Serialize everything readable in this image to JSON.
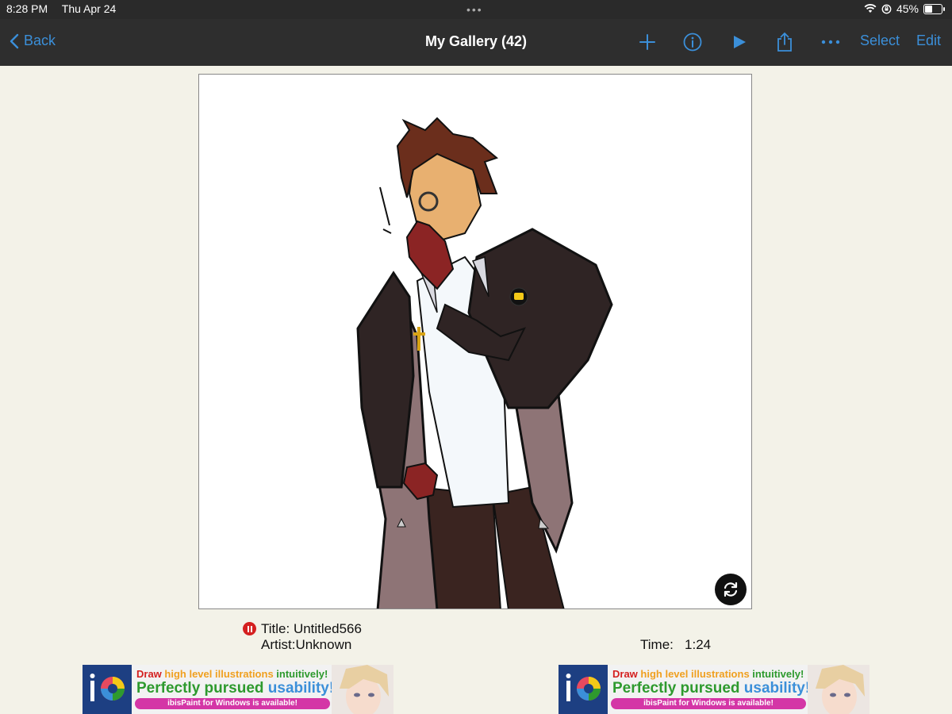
{
  "status": {
    "time": "8:28 PM",
    "date": "Thu Apr 24",
    "battery": "45%",
    "battery_level": 0.45
  },
  "nav": {
    "back": "Back",
    "title": "My Gallery (42)",
    "select": "Select",
    "edit": "Edit"
  },
  "icons": [
    "chevron-left-icon",
    "plus-icon",
    "info-icon",
    "play-icon",
    "share-icon",
    "ellipsis-icon",
    "rotate-icon",
    "stop-icon",
    "wifi-icon",
    "lock-rotation-icon",
    "battery-icon"
  ],
  "artwork": {
    "title_label": "Title:",
    "title": "Untitled566",
    "artist_label": "Artist:",
    "artist": "Unknown",
    "time_label": "Time:",
    "time": "1:24"
  },
  "ad": {
    "line1_a": "Draw",
    "line1_b": "high level illustrations",
    "line1_c": "intuitively!",
    "line2_a": "Perfectly pursued",
    "line2_b": "usability!",
    "line3": "ibisPaint for Windows is available!"
  },
  "colors": {
    "accent": "#3b8fd9",
    "bar": "#2e2e2e",
    "background": "#f3f2e8",
    "record": "#d42020",
    "ad_pink": "#d436a6"
  }
}
